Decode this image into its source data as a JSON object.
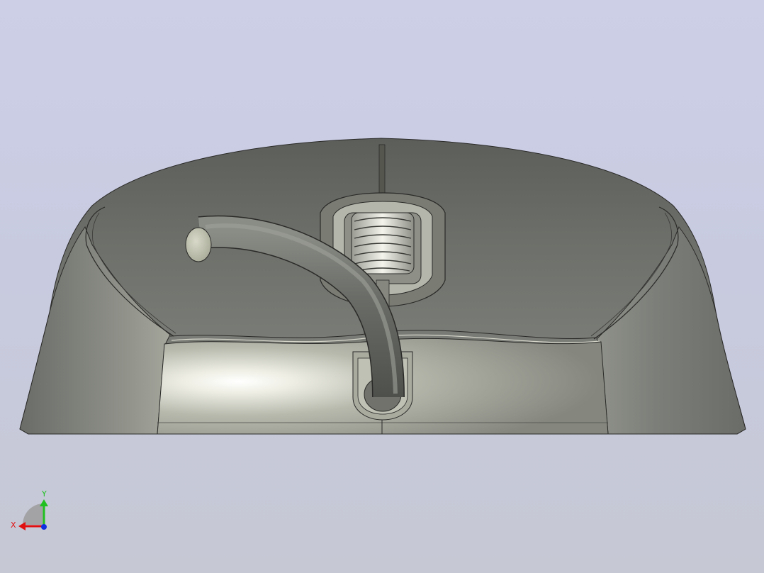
{
  "viewport": {
    "background_top": "#cdcfe7",
    "background_bottom": "#c6c8d4"
  },
  "model": {
    "icon": "mouse-body-3d-model"
  },
  "triad": {
    "x_label": "X",
    "y_label": "Y",
    "x_color": "#e01010",
    "y_color": "#20c020",
    "z_color": "#1030e0"
  }
}
